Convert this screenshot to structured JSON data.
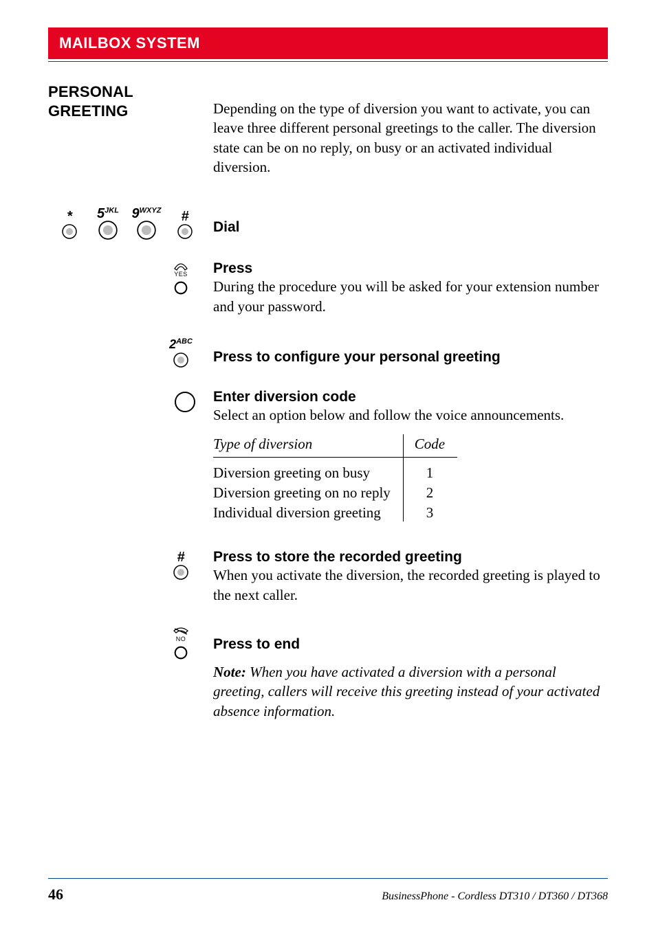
{
  "header": {
    "title": "MAILBOX SYSTEM"
  },
  "section": {
    "heading_line1": "PERSONAL",
    "heading_line2": "GREETING",
    "intro": "Depending on the type of diversion you want to activate, you can leave three different personal greetings to the caller. The diversion state can be on no reply, on busy or an activated individual diversion."
  },
  "steps": {
    "dial": {
      "heading": "Dial"
    },
    "press_yes": {
      "heading": "Press",
      "body": "During the procedure you will be asked for your extension number and your password."
    },
    "configure": {
      "heading": "Press to configure your personal greeting"
    },
    "enter_code": {
      "heading": "Enter diversion code",
      "body": "Select an option below and follow the voice announcements."
    },
    "store": {
      "heading": "Press to store the recorded greeting",
      "body": "When you activate the diversion, the recorded greeting is played to the next caller."
    },
    "end": {
      "heading": "Press to end"
    }
  },
  "keys": {
    "star": "*",
    "five": "5",
    "five_sup": "JKL",
    "nine": "9",
    "nine_sup": "WXYZ",
    "hash": "#",
    "two": "2",
    "two_sup": "ABC",
    "yes_label": "YES",
    "no_label": "NO"
  },
  "table": {
    "col1": "Type of diversion",
    "col2": "Code",
    "rows": [
      {
        "label": "Diversion greeting on busy",
        "code": "1"
      },
      {
        "label": "Diversion greeting on no reply",
        "code": "2"
      },
      {
        "label": "Individual diversion greeting",
        "code": "3"
      }
    ]
  },
  "note": {
    "prefix": "Note:",
    "body": " When you have activated a diversion with a personal greeting, callers will receive this greeting instead of your activated absence information."
  },
  "footer": {
    "page": "46",
    "product": "BusinessPhone - Cordless DT310 / DT360 / DT368"
  }
}
